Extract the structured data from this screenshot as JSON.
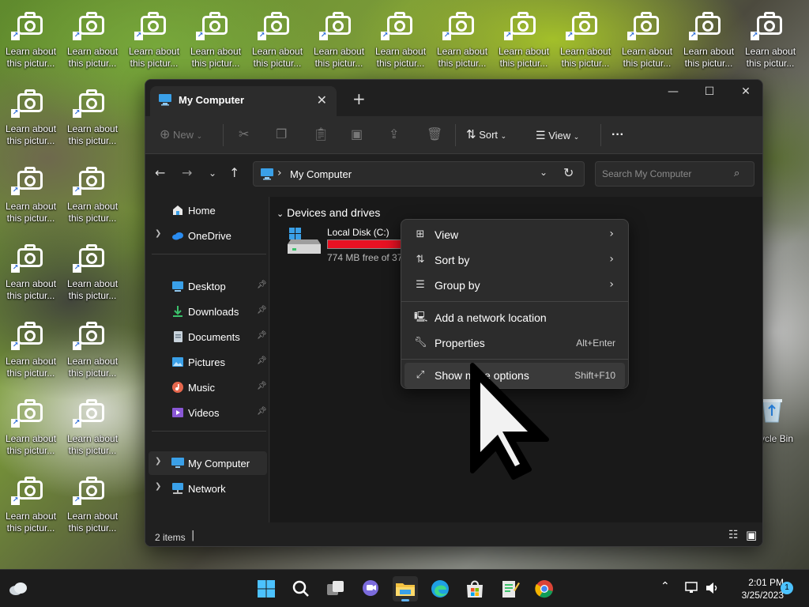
{
  "desktop": {
    "icon_label": "Learn about this pictur...",
    "recycle_label": "ycle Bin"
  },
  "explorer": {
    "tab_title": "My Computer",
    "toolbar": {
      "new_label": "New",
      "sort_label": "Sort",
      "view_label": "View",
      "more_label": "···"
    },
    "address": {
      "path": "My Computer"
    },
    "search": {
      "placeholder": "Search My Computer"
    },
    "sidebar": {
      "items": [
        {
          "label": "Home"
        },
        {
          "label": "OneDrive"
        },
        {
          "label": "Desktop"
        },
        {
          "label": "Downloads"
        },
        {
          "label": "Documents"
        },
        {
          "label": "Pictures"
        },
        {
          "label": "Music"
        },
        {
          "label": "Videos"
        },
        {
          "label": "My Computer"
        },
        {
          "label": "Network"
        }
      ]
    },
    "content": {
      "group_header": "Devices and drives",
      "drive": {
        "name": "Local Disk (C:)",
        "free_text": "774 MB free of 37.",
        "used_fraction": 0.98,
        "bar_color": "#e81123"
      }
    },
    "status": {
      "item_count": "2 items"
    }
  },
  "context_menu": {
    "items": [
      {
        "label": "View",
        "submenu": true
      },
      {
        "label": "Sort by",
        "submenu": true
      },
      {
        "label": "Group by",
        "submenu": true
      },
      {
        "label": "Add a network location"
      },
      {
        "label": "Properties",
        "shortcut": "Alt+Enter"
      },
      {
        "label": "Show more options",
        "shortcut": "Shift+F10"
      }
    ]
  },
  "taskbar": {
    "time": "2:01 PM",
    "date": "3/25/2023",
    "notification_count": "1",
    "accent": "#5fb2f2"
  }
}
